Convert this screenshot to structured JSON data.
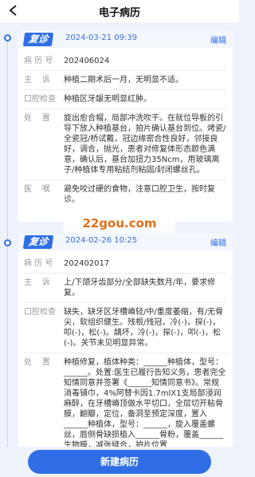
{
  "header": {
    "title": "电子病历"
  },
  "watermark": "22gou.com",
  "records": [
    {
      "badge": "复诊",
      "time": "2024-03-21 09:39",
      "edit": "编辑",
      "fields": {
        "record_no_label": "病 历 号",
        "record_no": "202406024",
        "complaint_label": "主    诉",
        "complaint": "种植二期术后一月，无明显不适。",
        "exam_label": "口腔检查",
        "exam": "种植区牙龈无明显红肿。",
        "treatment_label": "处    置",
        "treatment": "旋出愈合帽，局部冲洗吹干。在就位导板的引导下放入种植基台，拍片确认基台到位。烤瓷/全瓷冠/桥试戴，冠边缘密合性良好，邻接良好，调合，抛光，患者对修复体形态颜色满意，确认后，基台加扭力35Ncm，用玻璃离子/种植体专用粘结剂粘固/封闭螺丝孔。",
        "advice_label": "医    嘱",
        "advice": "避免咬过硬的食物，注意口腔卫生，按时复诊。"
      }
    },
    {
      "badge": "复诊",
      "time": "2024-02-26 10:25",
      "edit": "编辑",
      "fields": {
        "record_no_label": "病 历 号",
        "record_no": "202402017",
        "complaint_label": "主    诉",
        "complaint": "上/下颌牙齿部分/全部缺失数月/年，要求修复。",
        "exam_label": "口腔检查",
        "exam": "缺失，缺牙区牙槽嵴轻/中/重度萎缩，有/无骨尖，软组织健生。残根/残冠，冷(-)，探(-)，叩(-)，松(-)。龋坏，冷(-)，探(-)，叩(-)，松(-)。关节未见明显异常。",
        "treatment_label": "处    置",
        "treatment": "种植修复，植体种类：______种植体，型号：______。处置:医生已履行告知义务，患者完全知情同意并签署《______知情同意书》。常规消毒铺巾，4%阿替卡因1.7mlX1支局部浸润麻醉，在牙槽嵴顶做水平切口，全层切开粘骨膜，翻瓣，定位，备洞至预定深度，置入______种植体，型号：______，旋入覆盖螺丝，唇侧骨缺损植入______骨粉，覆盖______生物膜，减张缝合，拍片位置"
      }
    }
  ],
  "footer": {
    "new_button": "新建病历"
  }
}
